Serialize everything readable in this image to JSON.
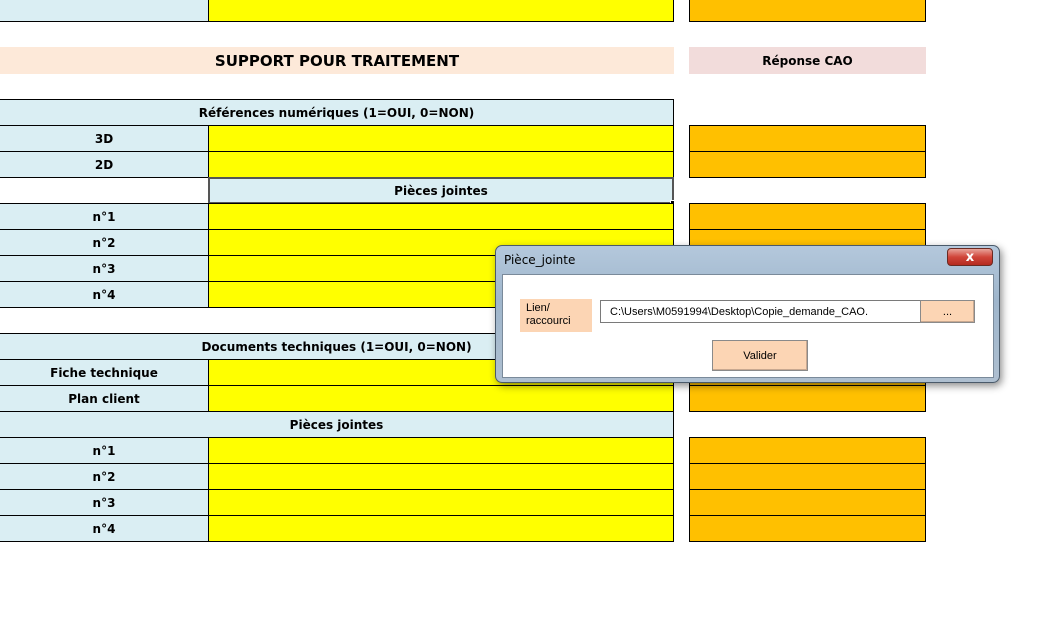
{
  "sheet": {
    "title": "SUPPORT POUR TRAITEMENT",
    "response_header": "Réponse CAO",
    "refs_header": "Références numériques (1=OUI, 0=NON)",
    "refs_rows": [
      "3D",
      "2D"
    ],
    "attachments_header_1": "Pièces jointes",
    "attachments_rows_1": [
      "n°1",
      "n°2",
      "n°3",
      "n°4"
    ],
    "docs_header": "Documents techniques  (1=OUI, 0=NON)",
    "docs_rows": [
      "Fiche technique",
      "Plan client"
    ],
    "attachments_header_2": "Pièces jointes",
    "attachments_rows_2": [
      "n°1",
      "n°2",
      "n°3",
      "n°4"
    ]
  },
  "colors": {
    "label_fill": "#daeef3",
    "input_fill": "#ffff00",
    "response_fill": "#ffc000",
    "title_fill": "#fde9d9",
    "response_header_fill": "#f2dcdb",
    "dialog_button_fill": "#fcd5b4"
  },
  "dialog": {
    "title": "Pièce_jointe",
    "close_label": "x",
    "field_label": "Lien/ raccourci",
    "field_value": "C:\\Users\\M0591994\\Desktop\\Copie_demande_CAO.",
    "browse_label": "...",
    "submit_label": "Valider"
  }
}
